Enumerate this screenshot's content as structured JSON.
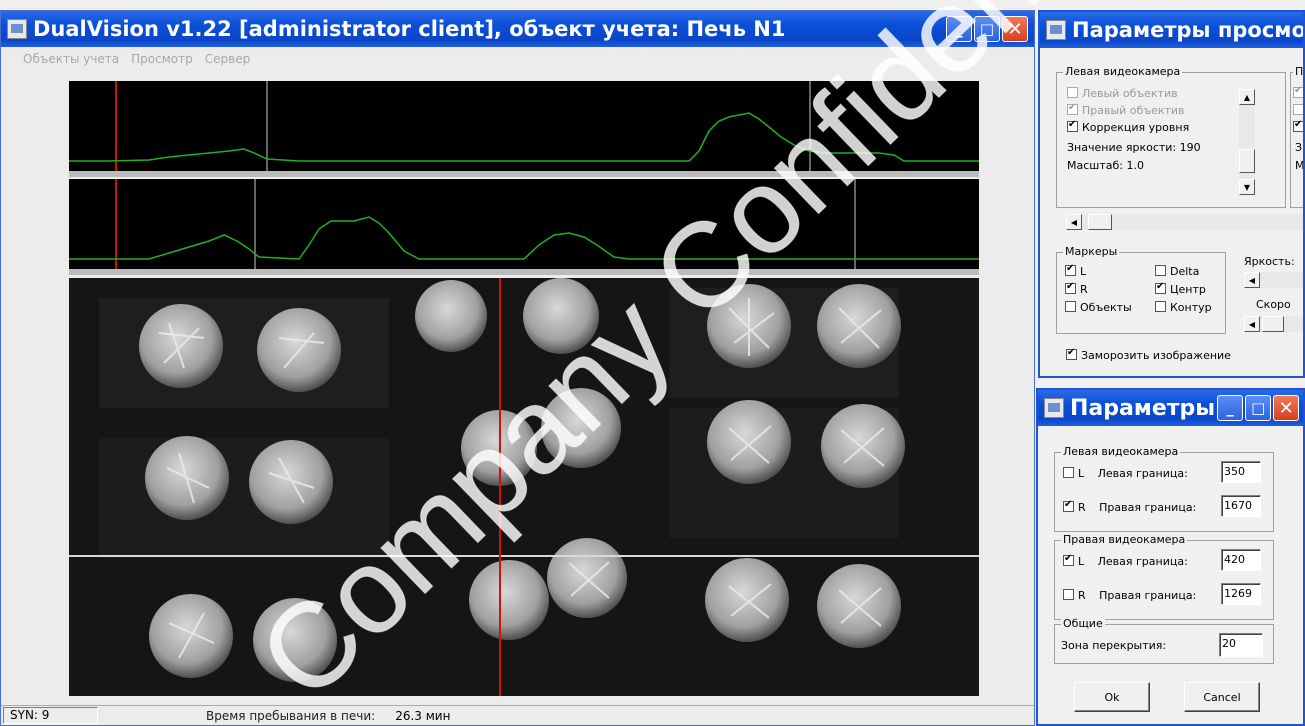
{
  "main_window": {
    "title": "DualVision v1.22 [administrator client], объект учета: Печь N1",
    "menu": [
      "Объекты учета",
      "Просмотр",
      "Сервер"
    ],
    "status": {
      "syn": "SYN: 9",
      "time_label": "Время пребывания в печи:",
      "time_value": "26.3 мин"
    },
    "watermark": "Company Confidential"
  },
  "view_params_window": {
    "title": "Параметры просмотра",
    "left_camera_group": "Левая видеокамера",
    "left_camera_items": [
      {
        "label": "Левый объектив",
        "checked": false,
        "disabled": true
      },
      {
        "label": "Правый объектив",
        "checked": true,
        "disabled": true
      },
      {
        "label": "Коррекция уровня",
        "checked": true,
        "disabled": false
      }
    ],
    "brightness_value": "Значение яркости: 190",
    "scale_value": "Масштаб: 1.0",
    "right_camera_group_first": "П",
    "right_camera_value_first": "З",
    "right_camera_scale_first": "М",
    "markers_group": "Маркеры",
    "markers": [
      {
        "label": "L",
        "checked": true
      },
      {
        "label": "Delta",
        "checked": false
      },
      {
        "label": "R",
        "checked": true
      },
      {
        "label": "Центр",
        "checked": true
      },
      {
        "label": "Объекты",
        "checked": false
      },
      {
        "label": "Контур",
        "checked": false
      }
    ],
    "brightness_label": "Яркость:",
    "speed_label": "Скоро",
    "freeze_label": "Заморозить изображение",
    "freeze_checked": true
  },
  "params_window": {
    "title": "Параметры",
    "left_camera_group": "Левая видеокамера",
    "left_rows": [
      {
        "flag": "L",
        "checked": false,
        "label": "Левая граница:",
        "value": "350"
      },
      {
        "flag": "R",
        "checked": true,
        "label": "Правая граница:",
        "value": "1670"
      }
    ],
    "right_camera_group": "Правая видеокамера",
    "right_rows": [
      {
        "flag": "L",
        "checked": true,
        "label": "Левая граница:",
        "value": "420"
      },
      {
        "flag": "R",
        "checked": false,
        "label": "Правая граница:",
        "value": "1269"
      }
    ],
    "common_group": "Общие",
    "overlap_label": "Зона перекрытия:",
    "overlap_value": "20",
    "ok_label": "Ok",
    "cancel_label": "Cancel"
  }
}
